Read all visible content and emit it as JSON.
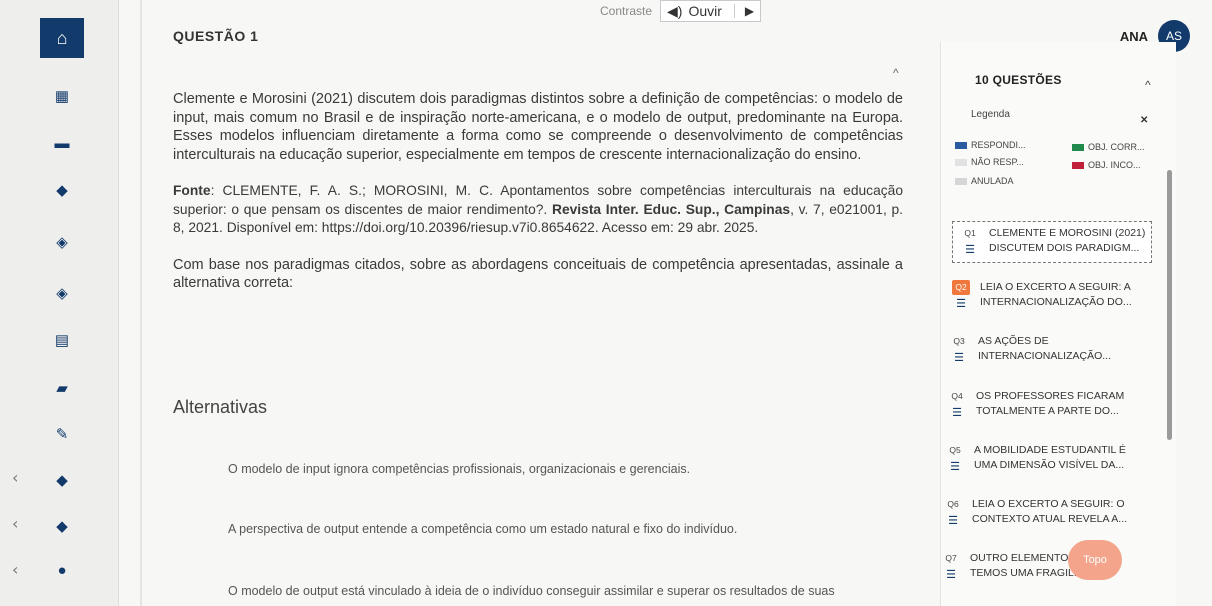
{
  "header": {
    "question_title": "QUESTÃO 1",
    "contraste_label": "Contraste",
    "ouvir_label": "Ouvir",
    "ouvir_icon": "speaker-icon",
    "play_icon": "play-icon",
    "user_name": "ANA",
    "user_initials": "AS"
  },
  "sidebar": {
    "home_icon": "home-icon",
    "icons": [
      "calendar-icon",
      "board-icon",
      "graduation-cap-icon",
      "diamond-icon",
      "diamond-icon",
      "building-icon",
      "cap-icon",
      "pencil-icon",
      "cap-icon",
      "cap-icon",
      "disc-icon"
    ]
  },
  "question": {
    "paragraph1": "Clemente e Morosini (2021) discutem dois paradigmas distintos sobre a definição de competências: o modelo de input, mais comum no Brasil e de inspiração norte-americana, e o modelo de output, predominante na Europa. Esses modelos influenciam diretamente a forma como se compreende o desenvolvimento de competências interculturais na educação superior, especialmente em tempos de crescente internacionalização do ensino.",
    "fonte_label": "Fonte",
    "fonte_text": ": CLEMENTE, F. A. S.; MOROSINI, M. C. Apontamentos sobre competências interculturais na educação superior: o que pensam os discentes de maior rendimento?. ",
    "fonte_journal": "Revista Inter. Educ. Sup., Campinas",
    "fonte_rest": ", v. 7, e021001, p. 8, 2021. Disponível em: https://doi.org/10.20396/riesup.v7i0.8654622. Acesso em: 29 abr. 2025.",
    "paragraph3": "Com base nos paradigmas citados, sobre as abordagens conceituais de competência apresentadas, assinale a alternativa correta:",
    "alternatives_header": "Alternativas",
    "options": [
      "O modelo de input ignora competências profissionais, organizacionais e gerenciais.",
      "A perspectiva de output entende a competência como um estado natural e fixo do indivíduo.",
      "O modelo de output está vinculado à ideia de o indivíduo conseguir assimilar e superar os resultados de suas"
    ]
  },
  "panel": {
    "title": "10 QUESTÕES",
    "legend_title": "Legenda",
    "legend": [
      {
        "label": "RESPONDI...",
        "color": "#2c5aa0"
      },
      {
        "label": "OBJ. CORR...",
        "color": "#1f8a4c"
      },
      {
        "label": "NÃO RESP...",
        "color": "#e2e2e2"
      },
      {
        "label": "OBJ. INCO...",
        "color": "#c0203a"
      },
      {
        "label": "ANULADA",
        "color": "#d6d6d6"
      }
    ],
    "questions": [
      {
        "num": "Q1",
        "line1": "Clemente e Morosini (2021)",
        "line2": "discutem dois paradigm..."
      },
      {
        "num": "Q2",
        "line1": "Leia o excerto a seguir: A",
        "line2": "internacionalização do..."
      },
      {
        "num": "Q3",
        "line1": "As ações de",
        "line2": "internacionalização..."
      },
      {
        "num": "Q4",
        "line1": "Os professores ficaram",
        "line2": "totalmente a parte do..."
      },
      {
        "num": "Q5",
        "line1": "A mobilidade estudantil é",
        "line2": "uma dimensão visível da..."
      },
      {
        "num": "Q6",
        "line1": "Leia o excerto a seguir: O",
        "line2": "contexto atual revela a..."
      },
      {
        "num": "Q7",
        "line1": "Outro elemento, é o",
        "line2": "temos uma fragilidade..."
      }
    ],
    "topo_label": "Topo"
  }
}
